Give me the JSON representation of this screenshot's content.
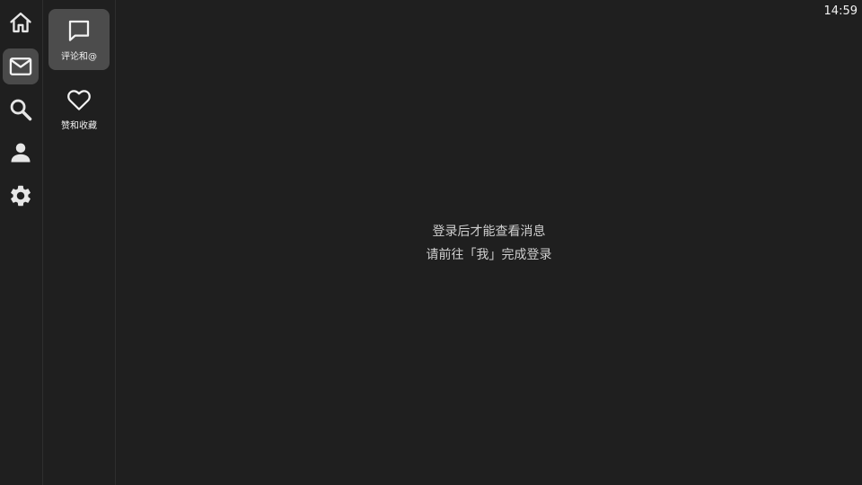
{
  "status_bar": {
    "time": "14:59"
  },
  "rail": {
    "items": [
      {
        "icon": "home-icon",
        "active": false
      },
      {
        "icon": "mail-icon",
        "active": true
      },
      {
        "icon": "search-icon",
        "active": false
      },
      {
        "icon": "person-icon",
        "active": false
      },
      {
        "icon": "gear-icon",
        "active": false
      }
    ]
  },
  "subnav": {
    "items": [
      {
        "label": "评论和@",
        "icon": "comment-icon",
        "active": true
      },
      {
        "label": "赞和收藏",
        "icon": "heart-icon",
        "active": false
      }
    ]
  },
  "main": {
    "line1": "登录后才能查看消息",
    "line2": "请前往「我」完成登录"
  },
  "colors": {
    "background": "#1f1f1f",
    "active_highlight": "#4a4a4a",
    "icon": "#e6e6e6",
    "text_secondary": "#cfcfcf"
  }
}
